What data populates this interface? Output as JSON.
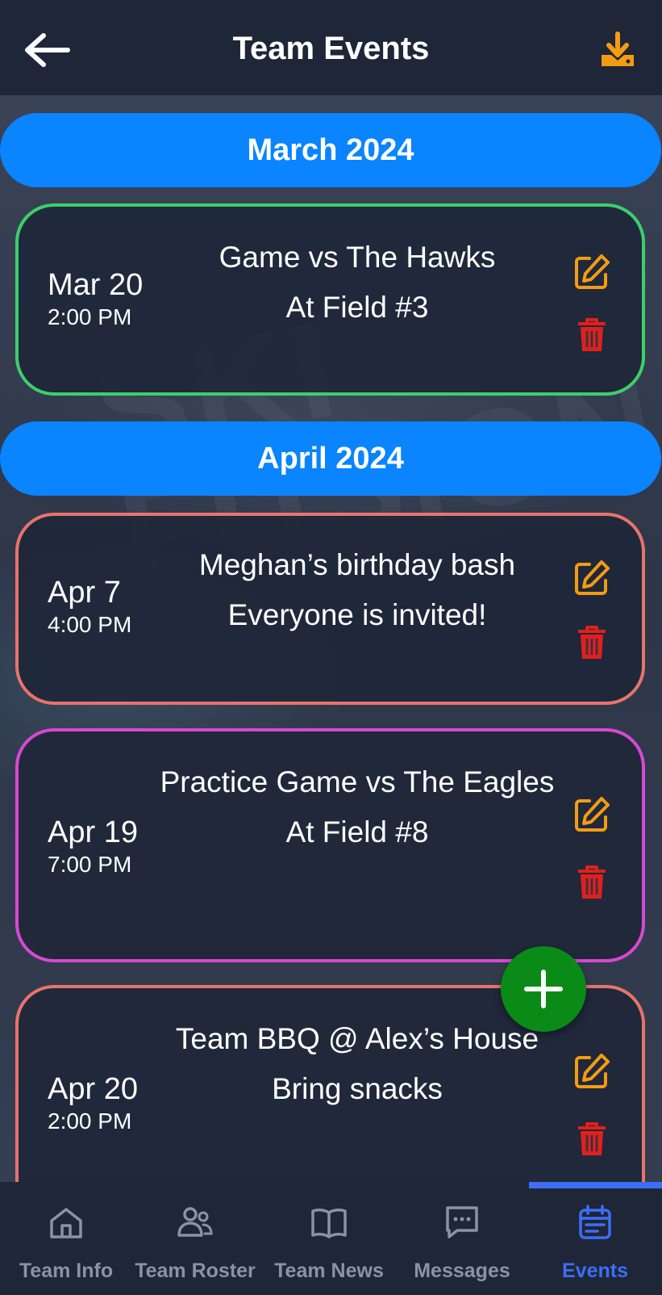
{
  "header": {
    "title": "Team Events",
    "back_icon": "arrow-left-icon",
    "download_icon": "download-icon"
  },
  "colors": {
    "header_bg": "#1e2638",
    "banner_blue": "#0a84ff",
    "edit_orange": "#f39c12",
    "delete_red": "#e0201c",
    "fab_green": "#0a8a17",
    "tab_active": "#3d6ef5",
    "tab_inactive": "#8a93a6"
  },
  "months": [
    {
      "label": "March 2024",
      "events": [
        {
          "date": "Mar 20",
          "time": "2:00 PM",
          "title": "Game vs The Hawks",
          "description": "At Field #3",
          "border_color": "#3ccf6b"
        }
      ]
    },
    {
      "label": "April 2024",
      "events": [
        {
          "date": "Apr 7",
          "time": "4:00 PM",
          "title": "Meghan’s birthday bash",
          "description": "Everyone is invited!",
          "border_color": "#e8736d"
        },
        {
          "date": "Apr 19",
          "time": "7:00 PM",
          "title": "Practice Game vs The Eagles",
          "description": "At Field #8",
          "border_color": "#d649d2"
        },
        {
          "date": "Apr 20",
          "time": "2:00 PM",
          "title": "Team BBQ @ Alex’s House",
          "description": "Bring snacks",
          "border_color": "#e8736d"
        }
      ]
    }
  ],
  "fab": {
    "icon": "plus-icon"
  },
  "tabs": [
    {
      "label": "Team Info",
      "icon": "home-icon",
      "active": false
    },
    {
      "label": "Team Roster",
      "icon": "users-icon",
      "active": false
    },
    {
      "label": "Team News",
      "icon": "book-icon",
      "active": false
    },
    {
      "label": "Messages",
      "icon": "message-icon",
      "active": false
    },
    {
      "label": "Events",
      "icon": "calendar-icon",
      "active": true
    }
  ]
}
